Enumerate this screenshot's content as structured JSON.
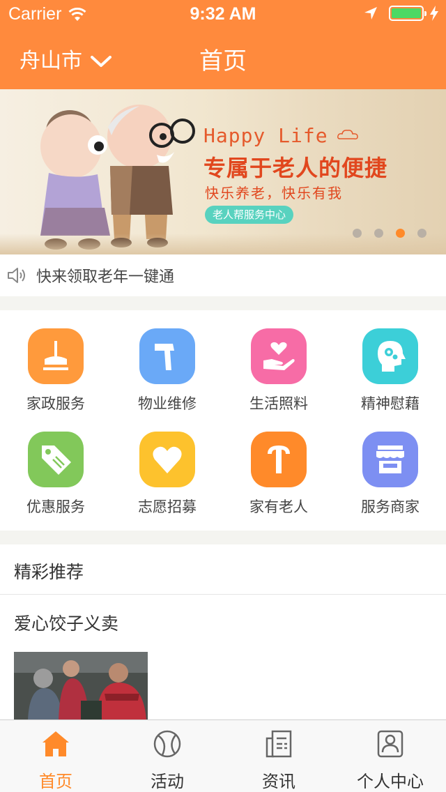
{
  "status_bar": {
    "carrier": "Carrier",
    "time": "9:32 AM",
    "icons": [
      "wifi-icon",
      "location-arrow-icon",
      "battery-icon",
      "charging-bolt-icon"
    ]
  },
  "header": {
    "city": "舟山市",
    "title": "首页",
    "background_color": "#ff8a3d"
  },
  "banner": {
    "heading": "Happy Life",
    "title": "专属于老人的便捷",
    "subtitle": "快乐养老，快乐有我",
    "badge": "老人帮服务中心",
    "slide_count": 4,
    "active_slide": 3,
    "accent_color": "#e1471e"
  },
  "notice": {
    "icon": "speaker-icon",
    "text": "快来领取老年一键通"
  },
  "services": [
    {
      "label": "家政服务",
      "icon": "broom-icon",
      "color": "#ff9a3c"
    },
    {
      "label": "物业维修",
      "icon": "hammer-icon",
      "color": "#6aa9f7"
    },
    {
      "label": "生活照料",
      "icon": "heart-hand-icon",
      "color": "#f76ca6"
    },
    {
      "label": "精神慰藉",
      "icon": "head-gear-icon",
      "color": "#3ccfd8"
    },
    {
      "label": "优惠服务",
      "icon": "tag-icon",
      "color": "#82c85a"
    },
    {
      "label": "志愿招募",
      "icon": "heart-icon",
      "color": "#fdc22d"
    },
    {
      "label": "家有老人",
      "icon": "cane-icon",
      "color": "#ff8a2a"
    },
    {
      "label": "服务商家",
      "icon": "storefront-icon",
      "color": "#7d8ff2"
    }
  ],
  "recommend": {
    "section_title": "精彩推荐",
    "articles": [
      {
        "title": "爱心饺子义卖",
        "image": "photo-dumpling-charity-sale"
      }
    ]
  },
  "tabbar": {
    "active_color": "#ff8a2a",
    "tabs": [
      {
        "label": "首页",
        "icon": "home-icon",
        "active": true
      },
      {
        "label": "活动",
        "icon": "ball-icon",
        "active": false
      },
      {
        "label": "资讯",
        "icon": "news-icon",
        "active": false
      },
      {
        "label": "个人中心",
        "icon": "profile-icon",
        "active": false
      }
    ]
  }
}
